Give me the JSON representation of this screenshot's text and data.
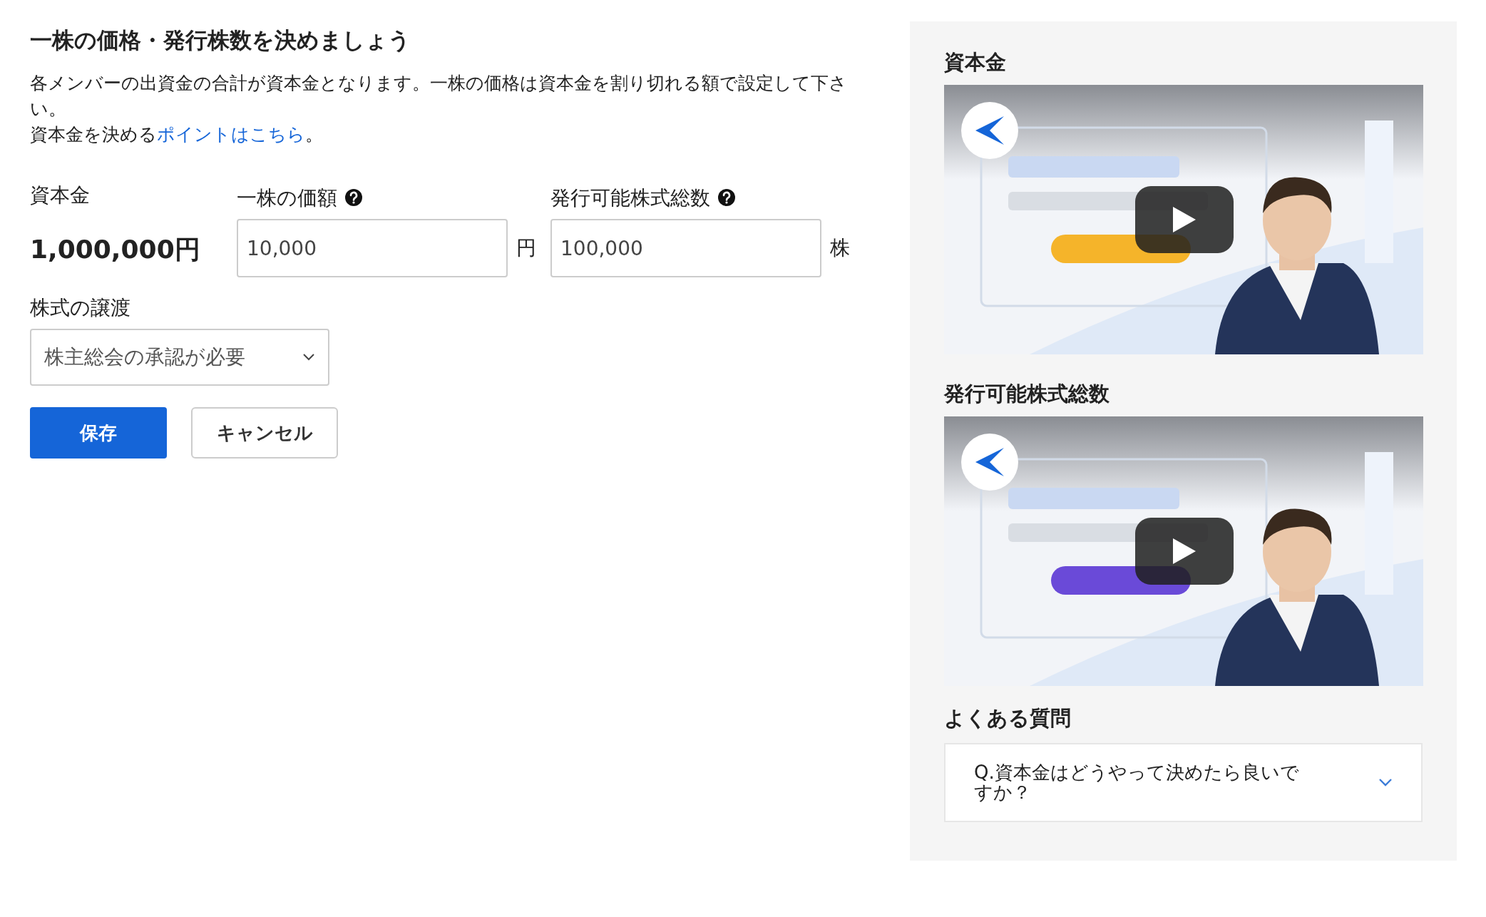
{
  "title": "一株の価格・発行株数を決めましょう",
  "description": {
    "line1": "各メンバーの出資金の合計が資本金となります。一株の価格は資本金を割り切れる額で設定して下さい。",
    "line2_before": "資本金を決める",
    "link": "ポイントはこちら",
    "line2_after": "。"
  },
  "capital": {
    "label": "資本金",
    "value": "1,000,000円"
  },
  "inputs": [
    {
      "label": "一株の価額",
      "value": "10,000",
      "unit": "円"
    },
    {
      "label": "発行可能株式総数",
      "value": "100,000",
      "unit": "株"
    }
  ],
  "transfer": {
    "label": "株式の譲渡",
    "value": "株主総会の承認が必要"
  },
  "buttons": [
    {
      "label": "保存",
      "kind": "primary"
    },
    {
      "label": "キャンセル",
      "kind": "secondary"
    }
  ],
  "sidebar": {
    "videos": [
      {
        "heading": "資本金",
        "kind": "picture"
      },
      {
        "heading": "発行可能株式総数",
        "kind": "picture"
      }
    ],
    "faq": {
      "heading": "よくある質問",
      "items": [
        {
          "question": "Q.資本金はどうやって決めたら良いですか？",
          "expanded": false
        }
      ]
    }
  }
}
